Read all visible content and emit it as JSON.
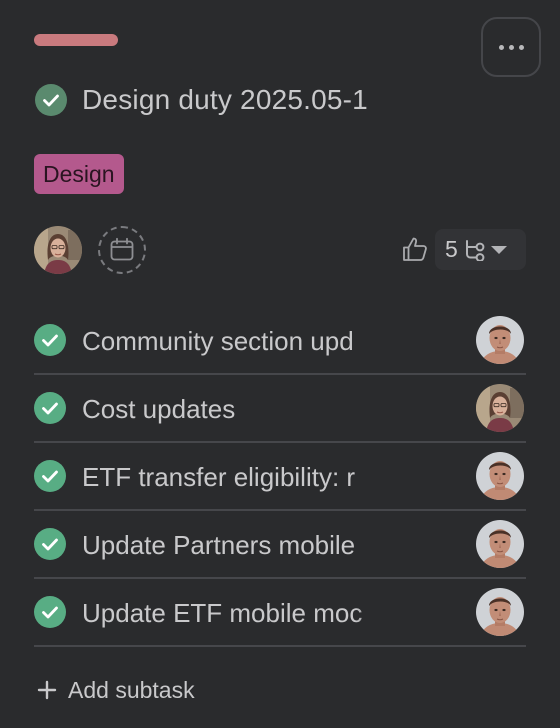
{
  "task": {
    "title": "Design duty 2025.05-1",
    "status": "completed",
    "tag": "Design",
    "assignee_avatar": "woman-avatar",
    "due_date_icon": "calendar-icon",
    "like_icon": "thumbs-up-icon",
    "subtask_count": "5",
    "subtask_icon": "subtask-icon",
    "more_icon": "ellipsis-icon"
  },
  "colors": {
    "background": "#2a2b2d",
    "progress": "#c97a7e",
    "tag_background": "#b4598d",
    "check_green": "#58ad84",
    "title_check": "#5a8a6e"
  },
  "subtasks": [
    {
      "name": "Community section upd",
      "completed": true,
      "assignee_avatar": "man-avatar"
    },
    {
      "name": "Cost updates",
      "completed": true,
      "assignee_avatar": "woman-avatar"
    },
    {
      "name": "ETF transfer eligibility: r",
      "completed": true,
      "assignee_avatar": "man-avatar"
    },
    {
      "name": "Update Partners mobile",
      "completed": true,
      "assignee_avatar": "man-avatar"
    },
    {
      "name": "Update ETF mobile moc",
      "completed": true,
      "assignee_avatar": "man-avatar"
    }
  ],
  "actions": {
    "add_subtask": "Add subtask"
  }
}
